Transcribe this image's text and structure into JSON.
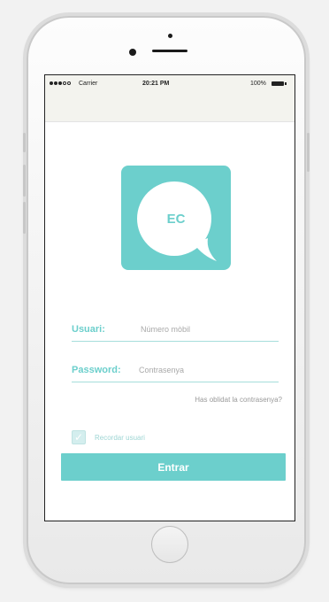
{
  "status_bar": {
    "carrier": "Carrier",
    "time": "20:21 PM",
    "battery": "100%"
  },
  "logo": {
    "text": "EC",
    "color": "#6ccfcc"
  },
  "form": {
    "user_label": "Usuari:",
    "user_placeholder": "Número mòbil",
    "password_label": "Password:",
    "password_placeholder": "Contrasenya",
    "forgot_link": "Has oblidat la contrasenya?",
    "remember_label": "Recordar usuari",
    "remember_checked": true,
    "submit_label": "Entrar"
  },
  "icons": {
    "signal": "signal-dots-icon",
    "battery": "battery-icon",
    "check": "checkmark-icon",
    "chat": "chat-bubble-icon"
  }
}
